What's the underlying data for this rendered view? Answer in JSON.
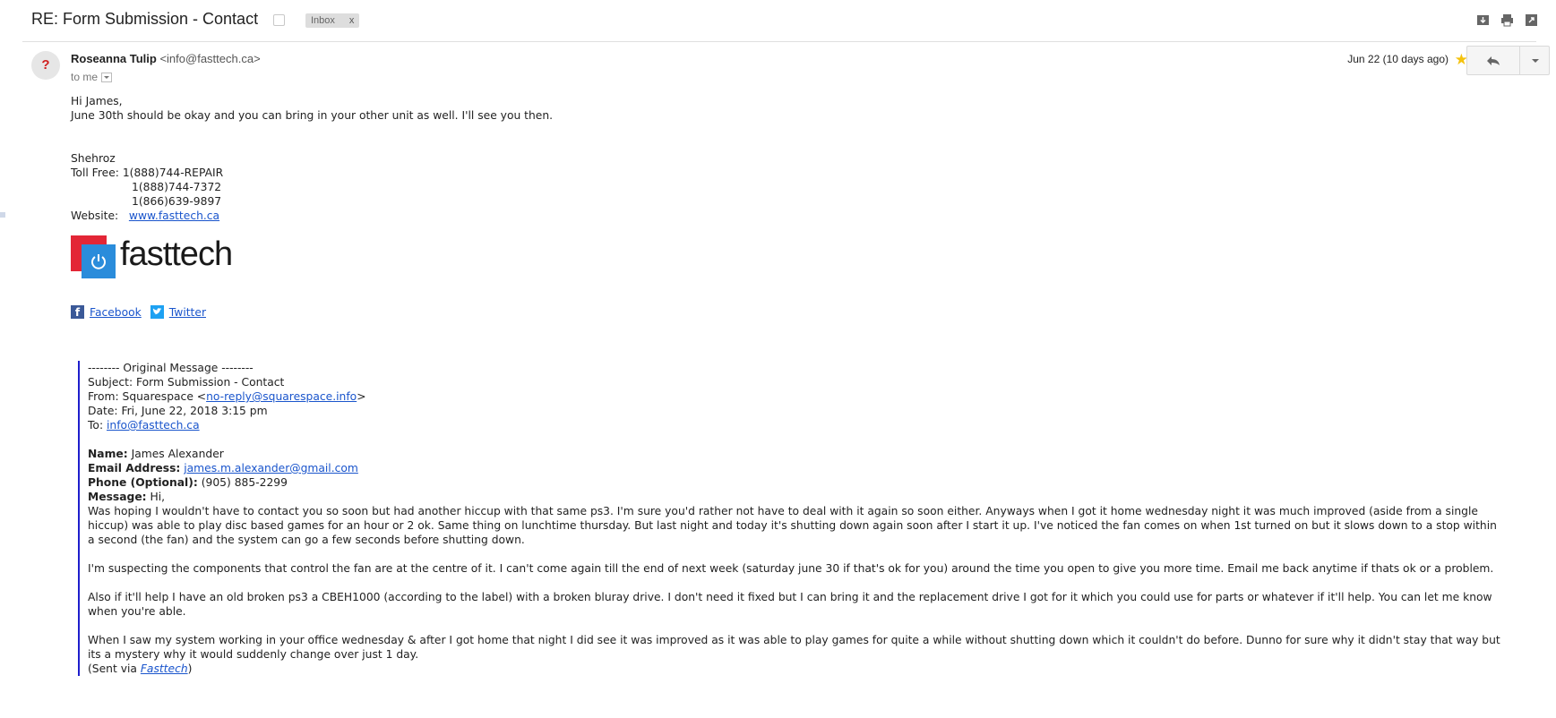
{
  "header": {
    "subject": "RE: Form Submission - Contact",
    "label": "Inbox",
    "label_remove": "x"
  },
  "message": {
    "sender_name": "Roseanna Tulip",
    "sender_email": "<info@fasttech.ca>",
    "to_me": "to me",
    "date": "Jun 22 (10 days ago)",
    "avatar_glyph": "?",
    "greeting": "Hi James,",
    "line1": "June 30th should be okay and you can bring in your other unit as well. I'll see you then."
  },
  "signature": {
    "name": "Shehroz",
    "tollfree_label": "Toll Free: ",
    "phone1": "1(888)744-REPAIR",
    "phone2": "1(888)744-7372",
    "phone3": "1(866)639-9897",
    "website_label": "Website:   ",
    "website": "www.fasttech.ca",
    "logo_text": "fasttech",
    "facebook": "Facebook",
    "twitter": "Twitter"
  },
  "quoted": {
    "header_line": "-------- Original Message --------",
    "subject": "Subject: Form Submission - Contact",
    "from_prefix": "From: Squarespace <",
    "from_email": "no-reply@squarespace.info",
    "from_suffix": ">",
    "date": "Date: Fri, June 22, 2018 3:15 pm",
    "to_prefix": "To: ",
    "to_email": "info@fasttech.ca",
    "name_label": "Name:",
    "name_value": " James Alexander",
    "email_label": "Email Address:",
    "email_value": "james.m.alexander@gmail.com",
    "phone_label": "Phone (Optional):",
    "phone_value": " (905) 885-2299",
    "message_label": "Message:",
    "message_value": " Hi,",
    "para1": "Was hoping I wouldn't have to contact you so soon but had another hiccup with that same ps3. I'm sure you'd rather not have to deal with it again so soon either. Anyways when I got it home wednesday night it was much improved (aside from a single hiccup) was able to play disc based games for an hour or 2 ok. Same thing on lunchtime thursday. But last night and today it's shutting down again soon after I start it up. I've noticed the fan comes on when 1st turned on but it slows down to a stop within a second (the fan) and the system can go a few seconds before shutting down.",
    "para2": "I'm suspecting the components that control the fan are at the centre of it. I can't come again till the end of next week (saturday june 30 if that's ok for you) around the time you open to give you more time. Email me back anytime if thats ok or a problem.",
    "para3": "Also if it'll help I have an old broken ps3 a CBEH1000 (according to the label) with a broken bluray drive. I don't need it fixed but I can bring it and the replacement drive I got for it which you could use for parts or whatever if it'll help. You can let me know when you're able.",
    "para4": "When I saw my system working in your office wednesday & after I got home that night I did see it was improved as it was able to play games for quite a while without shutting down which it couldn't do before. Dunno for sure why it didn't stay that way but its a mystery why it would suddenly change over just 1 day.",
    "sent_prefix": "(Sent via ",
    "sent_link": "Fasttech",
    "sent_suffix": ")"
  },
  "colors": {
    "link": "#1a55cc",
    "quote_bar": "#1e1ecc",
    "star": "#f4c20d",
    "logo_red": "#e32636",
    "logo_blue": "#2a8cdb"
  },
  "icons": [
    "archive-icon",
    "print-icon",
    "new-window-icon",
    "star-icon",
    "reply-icon",
    "more-options-icon",
    "facebook-icon",
    "twitter-icon",
    "power-icon"
  ]
}
